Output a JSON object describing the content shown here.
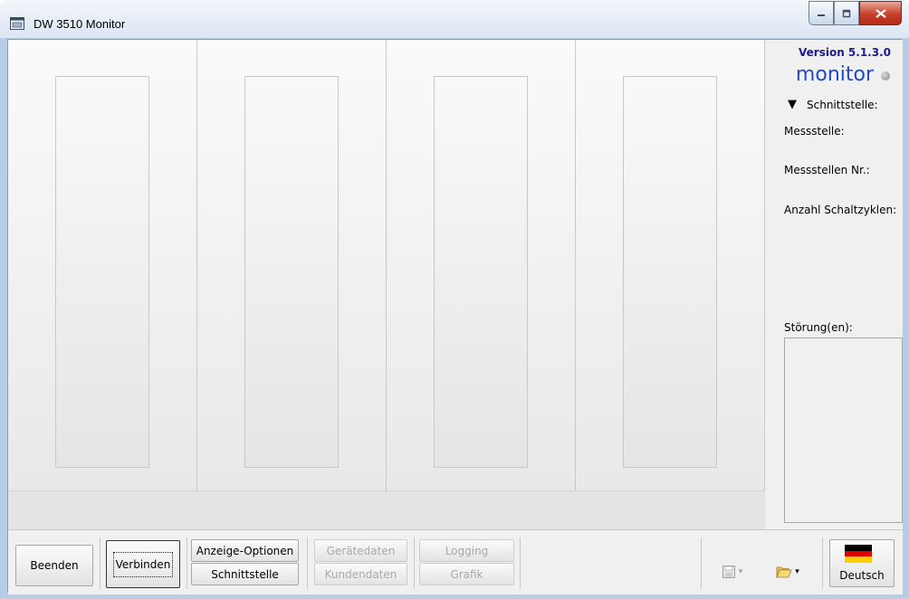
{
  "window": {
    "title": "DW 3510 Monitor",
    "controls": {
      "minimize": "–",
      "maximize": "□",
      "close": "X"
    }
  },
  "panels": [
    {},
    {},
    {},
    {}
  ],
  "side": {
    "version": "Version 5.1.3.0",
    "monitor": "monitor",
    "interface_toggle": "▼",
    "interface_label": "Schnittstelle:",
    "labels": {
      "measuring_point": "Messstelle:",
      "measuring_point_no": "Messstellen Nr.:",
      "switch_cycles": "Anzahl Schaltzyklen:",
      "faults": "Störung(en):"
    }
  },
  "buttons": {
    "quit": "Beenden",
    "connect": "Verbinden",
    "display_options": "Anzeige-Optionen",
    "interface": "Schnittstelle",
    "device_data": "Gerätedaten",
    "customer_data": "Kundendaten",
    "logging": "Logging",
    "graphic": "Grafik",
    "save_dropdown": "▾",
    "open_dropdown": "▾",
    "language": "Deutsch"
  },
  "colors": {
    "version_text": "#1b1b8f",
    "monitor_text": "#2048c8",
    "flag": [
      "#000000",
      "#dd0000",
      "#ffce00"
    ]
  },
  "icons": {
    "app": "app-window-icon",
    "save": "floppy-disk-icon",
    "open": "open-folder-icon",
    "language": "german-flag-icon"
  }
}
